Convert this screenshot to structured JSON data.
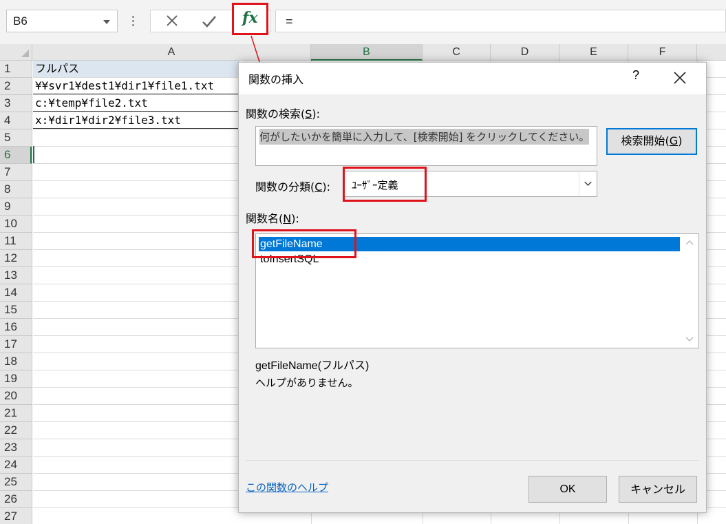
{
  "formula_bar": {
    "name_box": "B6",
    "fx_label": "fx",
    "formula": "="
  },
  "grid": {
    "columns": [
      "A",
      "B",
      "C",
      "D",
      "E",
      "F"
    ],
    "rows": [
      "1",
      "2",
      "3",
      "4",
      "5",
      "6",
      "7",
      "8",
      "9",
      "10",
      "11",
      "12",
      "13",
      "14",
      "15",
      "16",
      "17",
      "18",
      "19",
      "20",
      "21",
      "22",
      "23",
      "24",
      "25",
      "26",
      "27"
    ],
    "cells": {
      "A1": "フルパス",
      "A2": "¥¥svr1¥dest1¥dir1¥file1.txt",
      "A3": "c:¥temp¥file2.txt",
      "A4": "x:¥dir1¥dir2¥file3.txt"
    },
    "selected_cell": "B6"
  },
  "dialog": {
    "title": "関数の挿入",
    "help_glyph": "?",
    "search_label": "関数の検索(",
    "search_key": "S",
    "search_label_end": "):",
    "search_placeholder": "何がしたいかを簡単に入力して、[検索開始] をクリックしてください。",
    "search_button": "検索開始(",
    "search_button_key": "G",
    "search_button_end": ")",
    "category_label": "関数の分類(",
    "category_key": "C",
    "category_label_end": "):",
    "category_value": "ﾕｰｻﾞｰ定義",
    "function_name_label": "関数名(",
    "function_name_key": "N",
    "function_name_label_end": "):",
    "functions": [
      "getFileName",
      "toInsertSQL"
    ],
    "selected_function": "getFileName",
    "signature": "getFileName(フルパス)",
    "description": "ヘルプがありません。",
    "help_link": "この関数のヘルプ",
    "ok_button": "OK",
    "cancel_button": "キャンセル"
  },
  "colors": {
    "excel_green": "#217346",
    "highlight_red": "#e0121a",
    "selection_blue": "#0078d7",
    "link_blue": "#0563c1"
  }
}
